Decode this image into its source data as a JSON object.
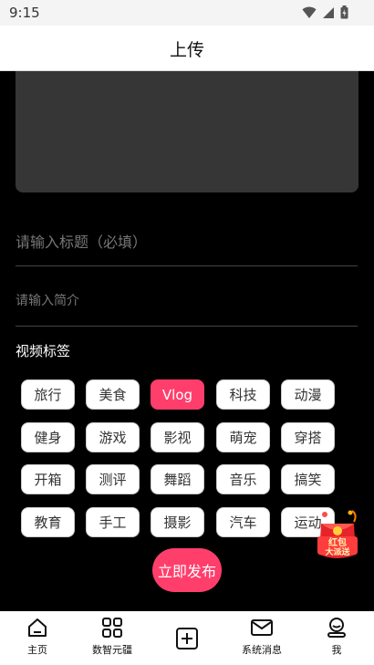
{
  "status": {
    "time": "9:15"
  },
  "header": {
    "title": "上传"
  },
  "form": {
    "title_placeholder": "请输入标题（必填）",
    "intro_placeholder": "请输入简介"
  },
  "tags": {
    "label": "视频标签",
    "selected": "Vlog",
    "items": [
      "旅行",
      "美食",
      "Vlog",
      "科技",
      "动漫",
      "健身",
      "游戏",
      "影视",
      "萌宠",
      "穿搭",
      "开箱",
      "测评",
      "舞蹈",
      "音乐",
      "搞笑",
      "教育",
      "手工",
      "摄影",
      "汽车",
      "运动"
    ]
  },
  "publish": {
    "label": "立即发布"
  },
  "promo": {
    "text_top": "红包",
    "text_bottom": "大派送"
  },
  "tabbar": {
    "items": [
      {
        "label": "主页",
        "icon": "home-icon"
      },
      {
        "label": "数智元疆",
        "icon": "grid-icon"
      },
      {
        "label": "",
        "icon": "add-icon"
      },
      {
        "label": "系统消息",
        "icon": "mail-icon"
      },
      {
        "label": "我",
        "icon": "profile-icon"
      }
    ]
  },
  "colors": {
    "accent": "#ff3e6c",
    "background": "#000000",
    "media_box": "#363636"
  }
}
